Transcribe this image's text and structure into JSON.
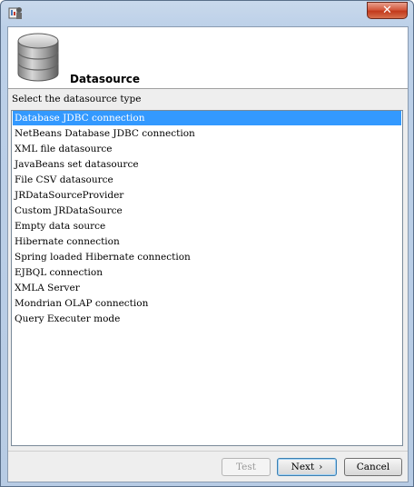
{
  "window": {
    "title": "",
    "close_glyph": "✕",
    "app_icon": "ireport-app-icon"
  },
  "header": {
    "title": "Datasource",
    "icon": "database-icon"
  },
  "datasource_list": {
    "label": "Select the datasource type",
    "selected_index": 0,
    "items": [
      "Database JDBC connection",
      "NetBeans Database JDBC connection",
      "XML file datasource",
      "JavaBeans set datasource",
      "File CSV datasource",
      "JRDataSourceProvider",
      "Custom JRDataSource",
      "Empty data source",
      "Hibernate connection",
      "Spring loaded Hibernate connection",
      "EJBQL connection",
      "XMLA Server",
      "Mondrian OLAP connection",
      "Query Executer mode"
    ]
  },
  "buttons": {
    "test": "Test",
    "next": "Next",
    "next_arrow": "›",
    "cancel": "Cancel"
  },
  "colors": {
    "selection": "#3399ff",
    "close_button": "#c23a1c"
  }
}
